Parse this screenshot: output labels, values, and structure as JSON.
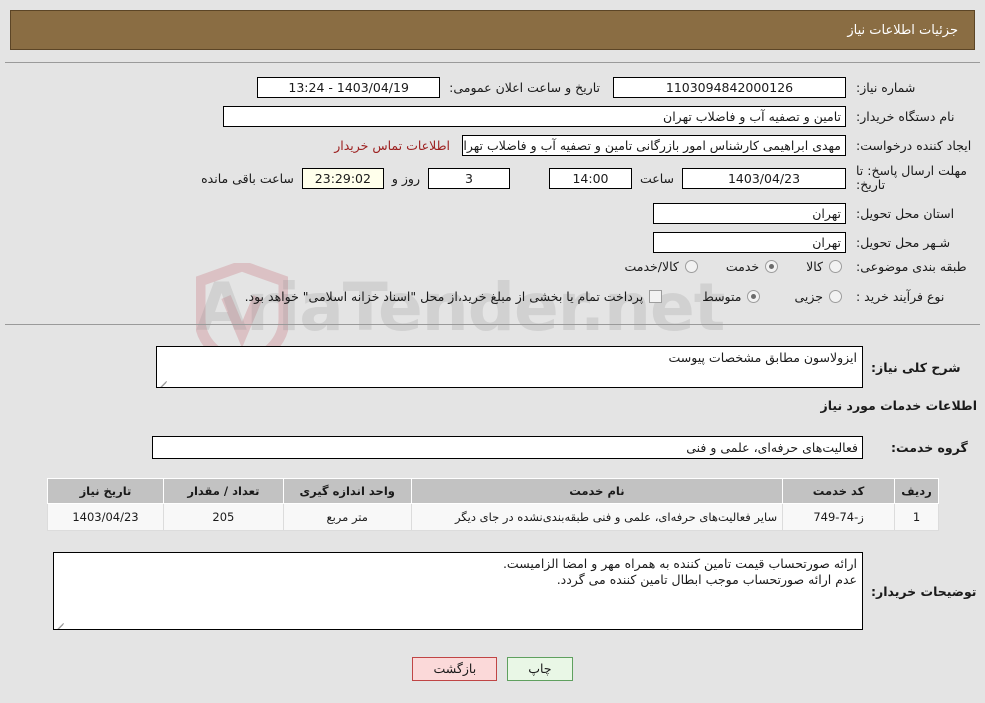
{
  "header": {
    "title": "جزئیات اطلاعات نیاز"
  },
  "form": {
    "need_number_label": "شماره نیاز:",
    "need_number_value": "1103094842000126",
    "announce_datetime_label": "تاریخ و ساعت اعلان عمومی:",
    "announce_datetime_value": "1403/04/19 - 13:24",
    "buyer_org_label": "نام دستگاه خریدار:",
    "buyer_org_value": "تامین و تصفیه آب و فاضلاب تهران",
    "request_creator_label": "ایجاد کننده درخواست:",
    "request_creator_value": "مهدی ابراهیمی کارشناس امور بازرگانی تامین و تصفیه آب و فاضلاب تهران",
    "buyer_contact_link": "اطلاعات تماس خریدار",
    "deadline_label": "مهلت ارسال پاسخ: تا تاریخ:",
    "deadline_date": "1403/04/23",
    "deadline_hour_label": "ساعت",
    "deadline_time": "14:00",
    "remaining_days": "3",
    "remaining_days_label": "روز و",
    "remaining_time": "23:29:02",
    "remaining_suffix_label": "ساعت باقی مانده",
    "province_label": "استان محل تحویل:",
    "province_value": "تهران",
    "city_label": "شـهر محل تحویل:",
    "city_value": "تهران",
    "category_label": "طبقه بندی موضوعی:",
    "category_options": [
      {
        "label": "کالا",
        "selected": false
      },
      {
        "label": "خدمت",
        "selected": true
      },
      {
        "label": "کالا/خدمت",
        "selected": false
      }
    ],
    "process_label": "نوع فرآیند خرید :",
    "process_options": [
      {
        "label": "جزیی",
        "selected": false
      },
      {
        "label": "متوسط",
        "selected": true
      }
    ],
    "treasury_checkbox_checked": false,
    "treasury_text": "پرداخت تمام یا بخشی از مبلغ خرید،از محل \"اسناد خزانه اسلامی\" خواهد بود."
  },
  "description": {
    "label": "شرح کلی نیاز:",
    "value": "ایزولاسون مطابق مشخصات پیوست"
  },
  "services": {
    "section_title": "اطلاعات خدمات مورد نیاز",
    "group_label": "گروه خدمت:",
    "group_value": "فعالیت‌های حرفه‌ای، علمی و فنی",
    "table": {
      "columns": [
        "ردیف",
        "کد خدمت",
        "نام خدمت",
        "واحد اندازه گیری",
        "تعداد / مقدار",
        "تاریخ نیاز"
      ],
      "rows": [
        {
          "row": "1",
          "code": "ز-74-749",
          "name": "سایر فعالیت‌های حرفه‌ای، علمی و فنی طبقه‌بندی‌نشده در جای دیگر",
          "unit": "متر مربع",
          "quantity": "205",
          "date": "1403/04/23"
        }
      ]
    }
  },
  "buyer_notes": {
    "label": "توضیحات خریدار:",
    "line1": "ارائه صورتحساب قیمت تامین کننده به همراه مهر و امضا الزامیست.",
    "line2": "عدم ارائه صورتحساب موجب ابطال تامین کننده می گردد."
  },
  "buttons": {
    "back": "بازگشت",
    "print": "چاپ"
  },
  "watermark": {
    "text": "AriaTender.net"
  },
  "colors": {
    "header_bg": "#8a6d43",
    "page_bg": "#e4e4e4",
    "link": "#9d2020",
    "table_header_bg": "#c2c2c2",
    "timer_bg": "#ffffeb",
    "back_btn_bg": "#fbd9d9",
    "print_btn_bg": "#e9f7e6"
  }
}
